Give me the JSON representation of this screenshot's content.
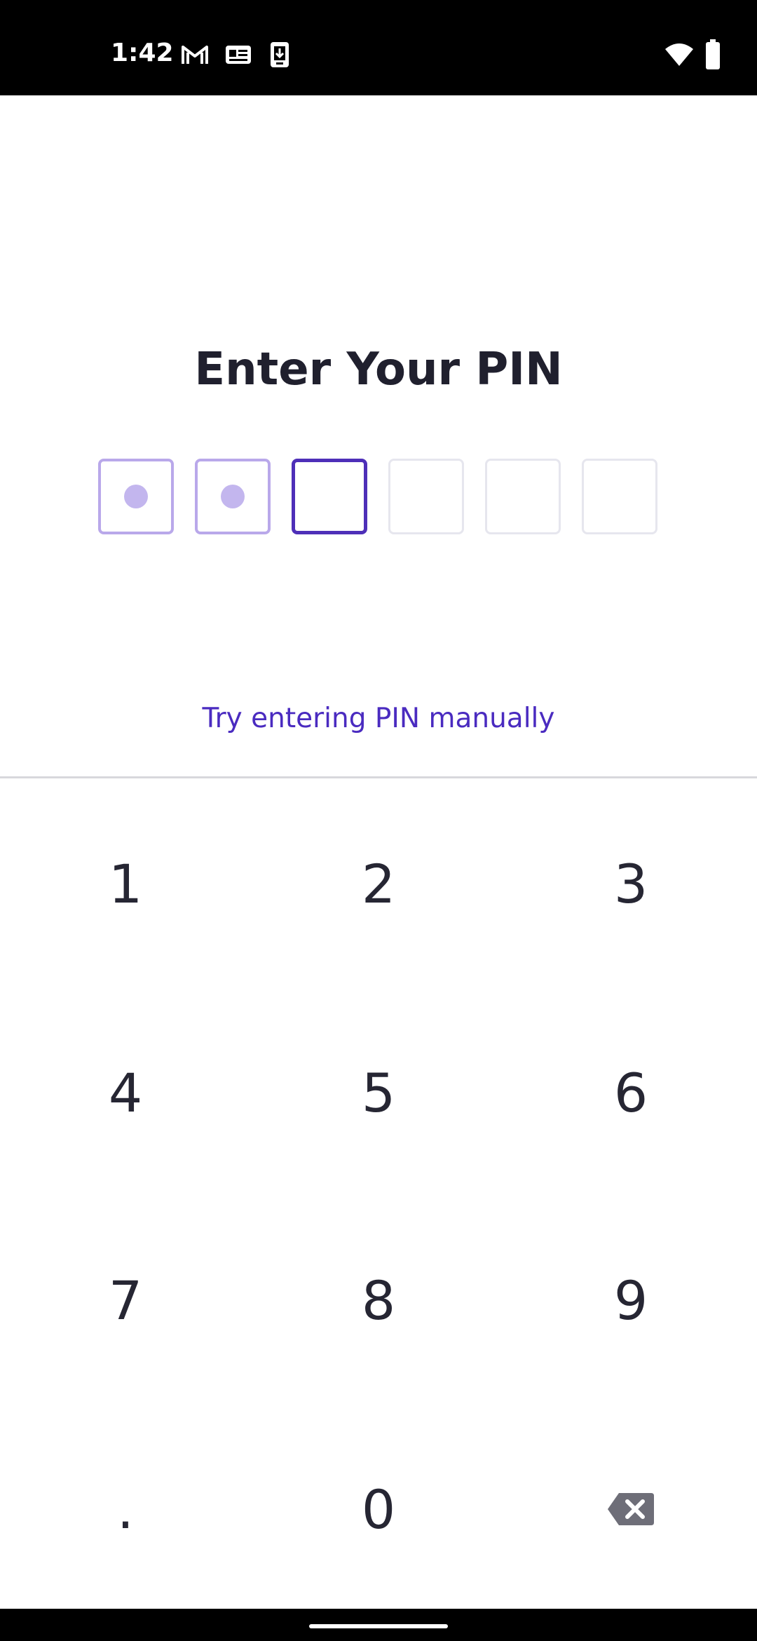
{
  "status_bar": {
    "time": "1:42",
    "icons_left": [
      "gmail-icon",
      "card-notification-icon",
      "download-icon"
    ],
    "icons_right": [
      "wifi-icon",
      "battery-icon"
    ]
  },
  "title": "Enter Your PIN",
  "pin": {
    "length": 6,
    "filled_count": 2,
    "active_index": 2
  },
  "manual_link": "Try entering PIN manually",
  "keypad": {
    "keys": [
      "1",
      "2",
      "3",
      "4",
      "5",
      "6",
      "7",
      "8",
      "9",
      ".",
      "0"
    ],
    "backspace_icon": "backspace-icon"
  },
  "colors": {
    "accent": "#4a2bc0",
    "filled_border": "#b9a8ea",
    "dot": "#c3b6ee",
    "empty_border": "#e6e6ee",
    "text": "#20202e"
  }
}
